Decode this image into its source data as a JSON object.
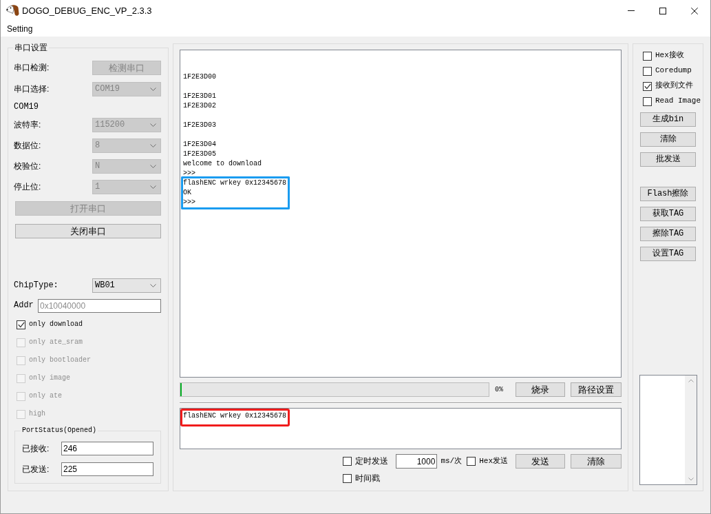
{
  "window": {
    "title": "DOGO_DEBUG_ENC_VP_2.3.3"
  },
  "menu": [
    "Setting"
  ],
  "serial_settings": {
    "title": "串口设置",
    "rows": [
      {
        "kind": "button",
        "label": "串口检测:",
        "button": "检测串口",
        "disabled": true
      },
      {
        "kind": "combo",
        "label": "串口选择:",
        "value": "COM19",
        "disabled": true
      },
      {
        "kind": "text",
        "label": "COM19"
      },
      {
        "kind": "combo",
        "label": "波特率:",
        "value": "115200",
        "disabled": true
      },
      {
        "kind": "combo",
        "label": "数据位:",
        "value": "8",
        "disabled": true
      },
      {
        "kind": "combo",
        "label": "校验位:",
        "value": "N",
        "disabled": true
      },
      {
        "kind": "combo",
        "label": "停止位:",
        "value": "1",
        "disabled": true
      },
      {
        "kind": "wide_button",
        "button": "打开串口",
        "disabled": true
      },
      {
        "kind": "wide_button",
        "button": "关闭串口",
        "disabled": false
      }
    ]
  },
  "chip": {
    "chip_type": {
      "label": "ChipType:",
      "value": "WB01",
      "disabled": false
    },
    "addr": {
      "label": "Addr",
      "placeholder": "0x10040000"
    }
  },
  "download_options": [
    {
      "label": "only download",
      "checked": true,
      "disabled": false
    },
    {
      "label": "only ate_sram",
      "checked": false,
      "disabled": true
    },
    {
      "label": "only bootloader",
      "checked": false,
      "disabled": true
    },
    {
      "label": "only image",
      "checked": false,
      "disabled": true
    },
    {
      "label": "only ate",
      "checked": false,
      "disabled": true
    },
    {
      "label": "high",
      "checked": false,
      "disabled": true
    }
  ],
  "port_status": {
    "title": "PortStatus(Opened)",
    "counters": [
      {
        "label": "已接收:",
        "value": "246"
      },
      {
        "label": "已发送:",
        "value": "225"
      }
    ]
  },
  "log": {
    "blocks": [
      [
        {
          "text": "1F2E3D00",
          "highlighted": false
        }
      ],
      [
        {
          "text": "1F2E3D01",
          "highlighted": false
        },
        {
          "text": "1F2E3D02",
          "highlighted": false
        }
      ],
      [
        {
          "text": "1F2E3D03",
          "highlighted": false
        }
      ],
      [
        {
          "text": "1F2E3D04",
          "highlighted": false
        },
        {
          "text": "1F2E3D05",
          "highlighted": false
        },
        {
          "text": "welcome to download",
          "highlighted": false
        },
        {
          "text": ">>>",
          "highlighted": false
        },
        {
          "text": "flashENC wrkey 0x12345678",
          "highlighted": true
        },
        {
          "text": "OK",
          "highlighted": true
        },
        {
          "text": ">>>",
          "highlighted": true
        }
      ]
    ],
    "highlight": {
      "color": "#1a9cf0"
    }
  },
  "progress": {
    "level": 0,
    "reading": "0%"
  },
  "progress_buttons": [
    "烧录",
    "路径设置"
  ],
  "send": {
    "value": "flashENC wrkey 0x12345678",
    "highlight": {
      "color": "#f01c1c"
    }
  },
  "send_controls": {
    "timed": {
      "label": "定时发送",
      "checked": false
    },
    "interval": {
      "value": "1000",
      "unit": "ms/次"
    },
    "hex": {
      "label": "Hex发送",
      "checked": false
    },
    "buttons": [
      "发送",
      "清除"
    ],
    "timestamp": {
      "label": "时间戳",
      "checked": false
    }
  },
  "receive_options": [
    {
      "label": "Hex接收",
      "checked": false
    },
    {
      "label": "Coredump",
      "checked": false
    },
    {
      "label": "接收到文件",
      "checked": true
    },
    {
      "label": "Read Image",
      "checked": false
    }
  ],
  "tool_buttons": [
    [
      "生成bin",
      "清除",
      "批发送"
    ],
    [
      "Flash擦除",
      "获取TAG",
      "擦除TAG",
      "设置TAG"
    ]
  ]
}
